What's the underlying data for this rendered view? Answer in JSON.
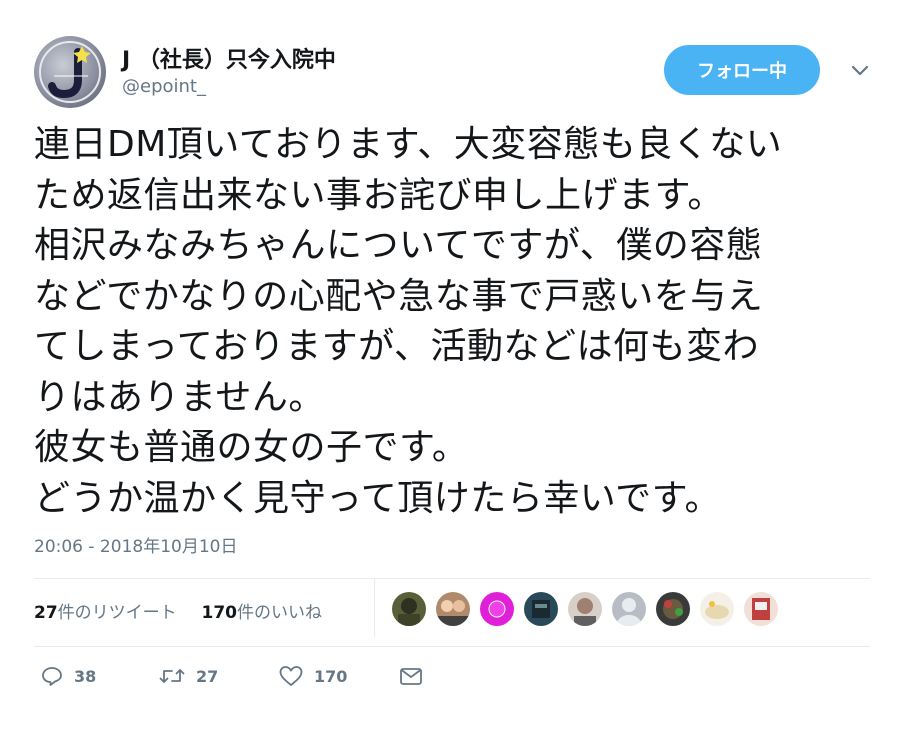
{
  "user": {
    "name": "J （社長）只今入院中",
    "handle": "@epoint_"
  },
  "follow_button": {
    "label": "フォロー中",
    "color": "#4ab3f4"
  },
  "tweet": {
    "lines": [
      "連日DM頂いております、大変容態も良くない",
      "ため返信出来ない事お詫び申し上げます。",
      "相沢みなみちゃんについてですが、僕の容態",
      "などでかなりの心配や急な事で戸惑いを与え",
      "てしまっておりますが、活動などは何も変わ",
      "りはありません。",
      "彼女も普通の女の子です。",
      "どうか温かく見守って頂けたら幸いです。"
    ],
    "timestamp": "20:06 - 2018年10月10日"
  },
  "stats": {
    "retweets_count": "27",
    "retweets_label": "件のリツイート",
    "likes_count": "170",
    "likes_label": "件のいいね"
  },
  "actions": {
    "reply_count": "38",
    "retweet_count": "27",
    "like_count": "170"
  },
  "icons": [
    "caret-down-icon",
    "reply-icon",
    "retweet-icon",
    "heart-icon",
    "message-icon"
  ],
  "liker_avatar_colors": [
    "#5a5f3a",
    "#b08a6a",
    "#e020d8",
    "#2a4a5a",
    "#a08070",
    "#b8bcc4",
    "#6a5a40",
    "#e8d8b0",
    "#c04040"
  ]
}
